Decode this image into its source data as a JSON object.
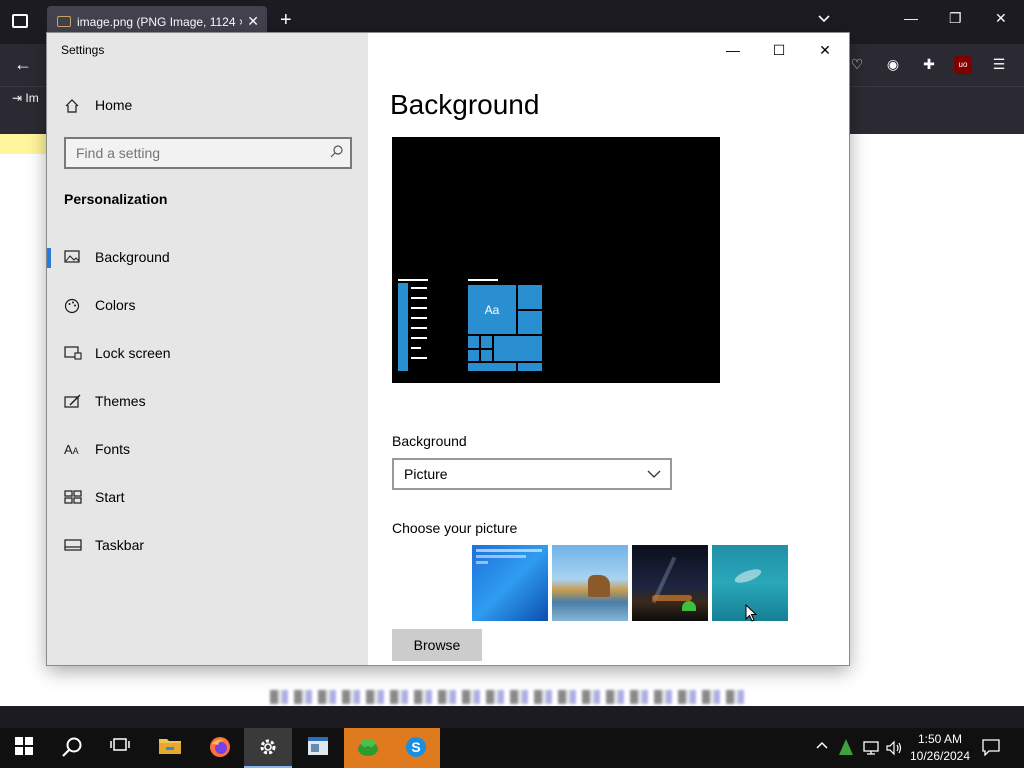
{
  "browser": {
    "tab_title": "image.png (PNG Image, 1124 ×",
    "tab_close": "✕",
    "new_tab": "+",
    "bookmark_label": "Im"
  },
  "settings": {
    "window_title": "Settings",
    "home_label": "Home",
    "search_placeholder": "Find a setting",
    "section_title": "Personalization",
    "nav_items": [
      {
        "label": "Background"
      },
      {
        "label": "Colors"
      },
      {
        "label": "Lock screen"
      },
      {
        "label": "Themes"
      },
      {
        "label": "Fonts"
      },
      {
        "label": "Start"
      },
      {
        "label": "Taskbar"
      }
    ],
    "page_title": "Background",
    "preview_sample": "Aa",
    "background_label": "Background",
    "background_value": "Picture",
    "choose_label": "Choose your picture",
    "browse_label": "Browse"
  },
  "taskbar": {
    "time": "1:50 AM",
    "date": "10/26/2024"
  },
  "colors": {
    "accent": "#2d7ad6",
    "tile_blue": "#2a8fd0",
    "sidebar_bg": "#e6e6e6",
    "taskbar_bg": "#101010",
    "orange_app": "#e07a1e"
  }
}
